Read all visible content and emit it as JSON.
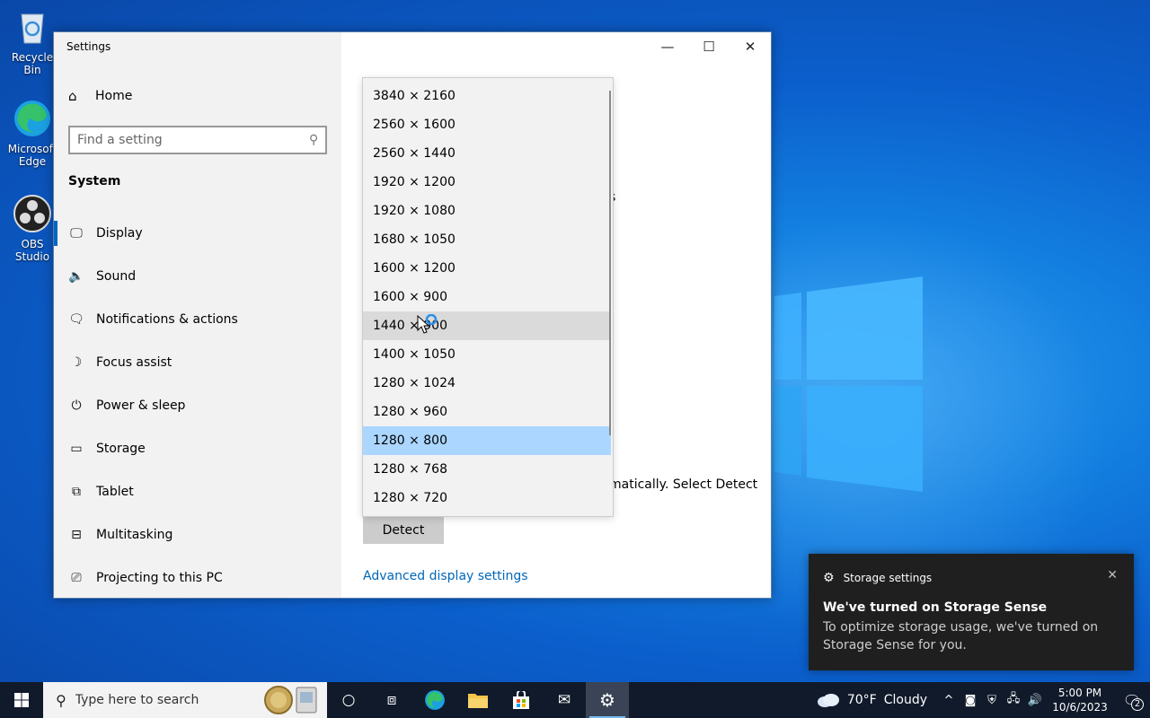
{
  "desktop": {
    "icons": [
      {
        "label": "Recycle Bin"
      },
      {
        "label": "Microsoft Edge"
      },
      {
        "label": "OBS Studio"
      }
    ]
  },
  "window": {
    "title": "Settings",
    "minimize": "—",
    "maximize": "☐",
    "close": "✕"
  },
  "sidebar": {
    "home_label": "Home",
    "search_placeholder": "Find a setting",
    "section_title": "System",
    "items": [
      {
        "label": "Display",
        "icon": "monitor-icon",
        "glyph": "🖵"
      },
      {
        "label": "Sound",
        "icon": "speaker-icon",
        "glyph": "🔈"
      },
      {
        "label": "Notifications & actions",
        "icon": "notification-icon",
        "glyph": "🗨"
      },
      {
        "label": "Focus assist",
        "icon": "moon-icon",
        "glyph": "☽"
      },
      {
        "label": "Power & sleep",
        "icon": "power-icon",
        "glyph": "⏻"
      },
      {
        "label": "Storage",
        "icon": "storage-icon",
        "glyph": "▭"
      },
      {
        "label": "Tablet",
        "icon": "tablet-icon",
        "glyph": "⧉"
      },
      {
        "label": "Multitasking",
        "icon": "multitasking-icon",
        "glyph": "⊟"
      },
      {
        "label": "Projecting to this PC",
        "icon": "projecting-icon",
        "glyph": "⎚"
      }
    ]
  },
  "content": {
    "partial_text_1": "s",
    "partial_text_2": "matically. Select Detect",
    "detect_button": "Detect",
    "advanced_link": "Advanced display settings"
  },
  "resolution_dropdown": {
    "options": [
      "3840 × 2160",
      "2560 × 1600",
      "2560 × 1440",
      "1920 × 1200",
      "1920 × 1080",
      "1680 × 1050",
      "1600 × 1200",
      "1600 × 900",
      "1440 × 900",
      "1400 × 1050",
      "1280 × 1024",
      "1280 × 960",
      "1280 × 800",
      "1280 × 768",
      "1280 × 720"
    ],
    "hovered_index": 8,
    "selected_index": 12
  },
  "toast": {
    "app_name": "Storage settings",
    "title": "We've turned on Storage Sense",
    "body": "To optimize storage usage, we've turned on Storage Sense for you.",
    "close": "✕"
  },
  "taskbar": {
    "search_placeholder": "Type here to search",
    "weather_temp": "70°F",
    "weather_desc": "Cloudy",
    "time": "5:00 PM",
    "date": "10/6/2023",
    "notification_count": "2",
    "tray_chevron": "^"
  },
  "colors": {
    "accent": "#0067c0",
    "selected_option": "#aad6ff",
    "taskbar": "#101a2b",
    "toast_bg": "#1f1f1f"
  }
}
